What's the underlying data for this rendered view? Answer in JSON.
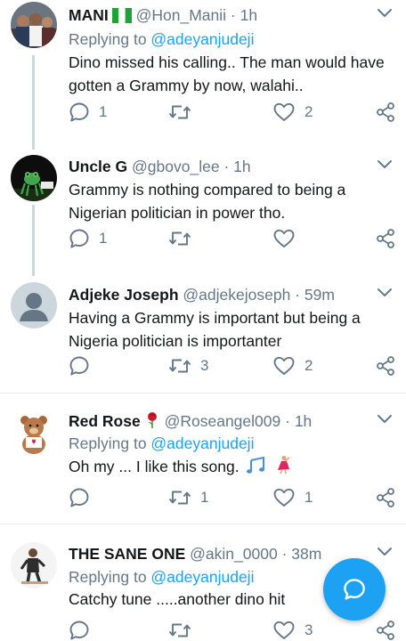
{
  "tweets": [
    {
      "name": "MANI",
      "flag": "nigeria-flag",
      "handle": "@Hon_Manii",
      "dot": "·",
      "time": "1h",
      "replying_prefix": "Replying to ",
      "replying_to": "@adeyanjudeji",
      "text": "Dino missed his calling.. The man would have gotten a Grammy by now, walahi..",
      "replies": "1",
      "retweets": "",
      "likes": "2"
    },
    {
      "name": "Uncle G",
      "handle": "@gbovo_lee",
      "dot": "·",
      "time": "1h",
      "text": "Grammy is nothing compared to being a Nigerian politician in power tho.",
      "replies": "1",
      "retweets": "",
      "likes": ""
    },
    {
      "name": "Adjeke Joseph",
      "handle": "@adjekejoseph",
      "dot": "·",
      "time": "59m",
      "text": "Having a Grammy is important but being a Nigeria politician is importanter",
      "replies": "",
      "retweets": "3",
      "likes": "2"
    },
    {
      "name": "Red Rose",
      "handle": "@Roseangel009",
      "dot": "·",
      "time": "1h",
      "replying_prefix": "Replying to ",
      "replying_to": "@adeyanjudeji",
      "text": "Oh my ... I like this song.",
      "replies": "",
      "retweets": "1",
      "likes": "1"
    },
    {
      "name": "THE SANE ONE",
      "handle": "@akin_0000",
      "dot": "·",
      "time": "38m",
      "replying_prefix": "Replying to ",
      "replying_to": "@adeyanjudeji",
      "text": "Catchy tune .....another dino hit",
      "replies": "",
      "retweets": "",
      "likes": "3"
    }
  ],
  "colors": {
    "accent": "#1da1f2",
    "text": "#14171a",
    "muted": "#657786",
    "divider": "#e6ecf0",
    "thread_line": "#ccd6dd"
  },
  "icons": {
    "reply": "reply-icon",
    "retweet": "retweet-icon",
    "like": "heart-icon",
    "share": "share-icon",
    "more": "chevron-down-icon",
    "compose": "compose-reply-icon"
  }
}
